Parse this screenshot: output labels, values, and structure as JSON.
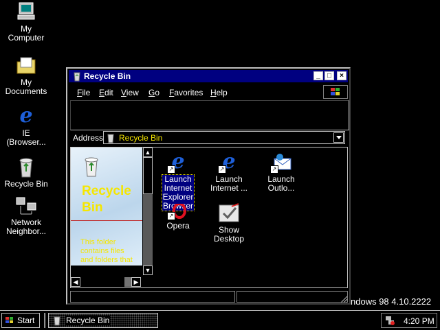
{
  "desktop": {
    "icons": [
      {
        "label": "My\nComputer",
        "icon": "computer-icon"
      },
      {
        "label": "My\nDocuments",
        "icon": "folder-icon"
      },
      {
        "label": "IE\n(Browser...",
        "icon": "ie-icon"
      },
      {
        "label": "Recycle Bin",
        "icon": "recycle-bin-icon"
      },
      {
        "label": "Network\nNeighbor...",
        "icon": "network-icon"
      }
    ],
    "version_text": "ndows 98 4.10.2222"
  },
  "window": {
    "title": "Recycle Bin",
    "menu": [
      {
        "key": "F",
        "rest": "ile"
      },
      {
        "key": "E",
        "rest": "dit"
      },
      {
        "key": "V",
        "rest": "iew"
      },
      {
        "key": "G",
        "rest": "o"
      },
      {
        "key": "F",
        "rest": "avorites"
      },
      {
        "key": "H",
        "rest": "elp"
      }
    ],
    "address_label": "Address",
    "address_value": "Recycle Bin",
    "webview": {
      "title": "Recycle Bin",
      "body": "This folder contains files and folders that you"
    },
    "items": [
      {
        "label": "Launch\nInternet\nExplorer\nBrowser",
        "icon": "ie-icon",
        "selected": true
      },
      {
        "label": "Launch\nInternet ...",
        "icon": "ie-icon",
        "selected": false
      },
      {
        "label": "Launch\nOutlo...",
        "icon": "outlook-icon",
        "selected": false
      },
      {
        "label": "Opera",
        "icon": "opera-icon",
        "selected": false
      },
      {
        "label": "Show\nDesktop",
        "icon": "show-desktop-icon",
        "selected": false
      }
    ]
  },
  "taskbar": {
    "start_label": "Start",
    "task_label": "Recycle Bin",
    "clock": "4:20 PM"
  },
  "colors": {
    "titlebar": "#000080",
    "selection": "#000080",
    "webview_title": "#f5e600"
  }
}
